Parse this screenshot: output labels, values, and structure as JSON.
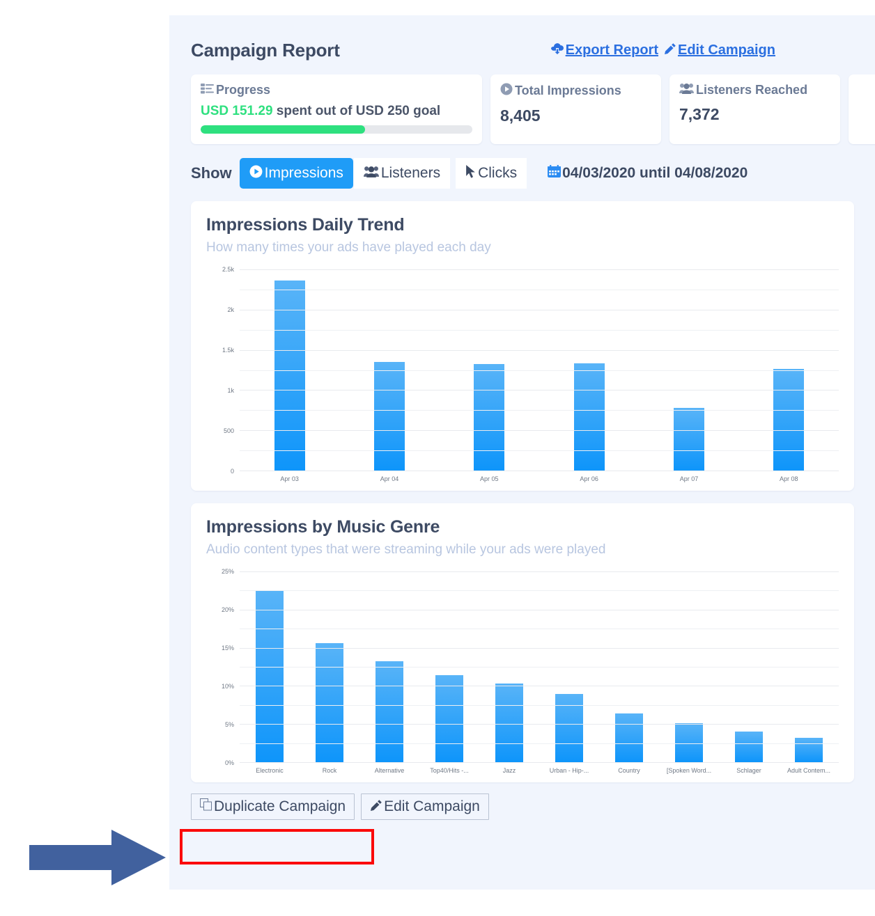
{
  "header": {
    "title": "Campaign Report",
    "export_label": "Export Report",
    "edit_label": "Edit Campaign"
  },
  "cards": {
    "progress": {
      "label": "Progress",
      "amount": "USD 151.29",
      "rest": " spent out of USD 250 goal",
      "fill_percent": 60.5,
      "fill_color": "#2ee07f"
    },
    "impressions": {
      "label": "Total Impressions",
      "value": "8,405"
    },
    "listeners": {
      "label": "Listeners Reached",
      "value": "7,372"
    }
  },
  "controls": {
    "show_label": "Show",
    "tabs": [
      {
        "label": "Impressions",
        "icon": "play-circle-icon",
        "active": true
      },
      {
        "label": "Listeners",
        "icon": "people-icon",
        "active": false
      },
      {
        "label": "Clicks",
        "icon": "cursor-icon",
        "active": false
      }
    ],
    "date_range": "04/03/2020 until 04/08/2020",
    "accent_color": "#1f9cf7"
  },
  "panels": [
    {
      "title": "Impressions Daily Trend",
      "subtitle": "How many times your ads have played each day"
    },
    {
      "title": "Impressions by Music Genre",
      "subtitle": "Audio content types that were streaming while your ads were played"
    }
  ],
  "footer": {
    "duplicate_label": "Duplicate Campaign",
    "edit_label": "Edit Campaign"
  },
  "annotations": {
    "highlight_color": "#fb0a0a",
    "arrow_color": "#41619e"
  },
  "chart_data": [
    {
      "type": "bar",
      "title": "Impressions Daily Trend",
      "subtitle": "How many times your ads have played each day",
      "xlabel": "",
      "ylabel": "",
      "categories": [
        "Apr 03",
        "Apr 04",
        "Apr 05",
        "Apr 06",
        "Apr 07",
        "Apr 08"
      ],
      "values": [
        2360,
        1350,
        1325,
        1330,
        775,
        1265
      ],
      "ylim": [
        0,
        2500
      ],
      "yticks": [
        0,
        500,
        1000,
        1500,
        2000,
        2500
      ],
      "ytick_labels": [
        "0",
        "500",
        "1k",
        "1.5k",
        "2k",
        "2.5k"
      ],
      "grid": true,
      "legend": "none",
      "bar_color": "#0e95fa"
    },
    {
      "type": "bar",
      "title": "Impressions by Music Genre",
      "subtitle": "Audio content types that were streaming while your ads were played",
      "xlabel": "",
      "ylabel": "",
      "categories": [
        "Electronic",
        "Rock",
        "Alternative",
        "Top40/Hits -...",
        "Jazz",
        "Urban - Hip-...",
        "Country",
        "[Spoken Word...",
        "Schlager",
        "Adult Contem..."
      ],
      "values": [
        22.5,
        15.6,
        13.2,
        11.4,
        10.3,
        8.9,
        6.4,
        5.1,
        4.0,
        3.2
      ],
      "ylim": [
        0,
        25
      ],
      "yticks": [
        0,
        5,
        10,
        15,
        20,
        25
      ],
      "ytick_labels": [
        "0%",
        "5%",
        "10%",
        "15%",
        "20%",
        "25%"
      ],
      "grid": true,
      "legend": "none",
      "bar_color": "#0e95fa"
    }
  ]
}
